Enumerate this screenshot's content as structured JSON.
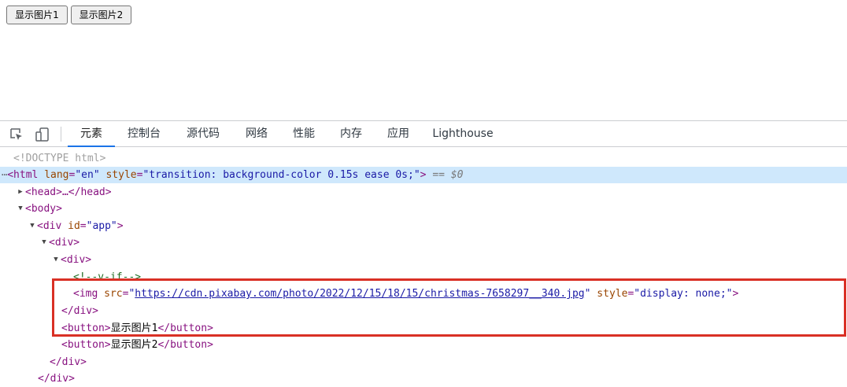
{
  "page": {
    "buttons": [
      "显示图片1",
      "显示图片2"
    ]
  },
  "devtools": {
    "tools": {
      "inspect": "inspect-element-icon",
      "device": "device-toolbar-icon"
    },
    "tabs": [
      "元素",
      "控制台",
      "源代码",
      "网络",
      "性能",
      "内存",
      "应用",
      "Lighthouse"
    ],
    "active_tab": "元素",
    "tree": {
      "doctype": "<!DOCTYPE html>",
      "html_open": "<html",
      "html_attr1_name": "lang",
      "html_attr1_val": "\"en\"",
      "html_attr2_name": "style",
      "html_attr2_val": "\"transition: background-color 0.15s ease 0s;\"",
      "html_close": ">",
      "selected_marker": "==",
      "selected_var": "$0",
      "head": "<head>…</head>",
      "body_open": "<body>",
      "div_app_open": "<div",
      "div_app_attr": "id",
      "div_app_val": "\"app\"",
      "div_app_close": ">",
      "div_open": "<div>",
      "div_inner_open": "<div>",
      "comment": "<!--v-if-->",
      "img_open": "<img",
      "img_src_attr": "src",
      "img_src_val": "https://cdn.pixabay.com/photo/2022/12/15/18/15/christmas-7658297__340.jpg",
      "img_style_attr": "style",
      "img_style_val": "\"display: none;\"",
      "img_close": ">",
      "div_inner_close": "</div>",
      "button1_open": "<button>",
      "button1_text": "显示图片1",
      "button1_close": "</button>",
      "button2_open": "<button>",
      "button2_text": "显示图片2",
      "button2_close": "</button>",
      "div_close": "</div>",
      "div_app_close_tag": "</div>"
    }
  },
  "colors": {
    "tag": "#881280",
    "attr_name": "#994500",
    "attr_value": "#1a1aa6",
    "comment": "#236e25",
    "selection": "#cfe8fc",
    "highlight_border": "#d93025",
    "active_tab_indicator": "#1a73e8"
  }
}
